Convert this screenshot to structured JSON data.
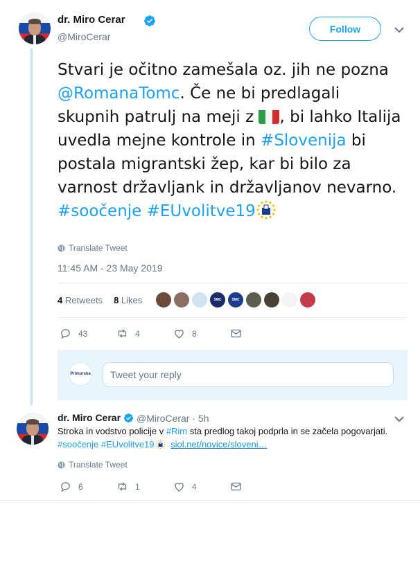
{
  "main_tweet": {
    "author_name": "dr. Miro Cerar",
    "author_handle": "@MiroCerar",
    "follow_label": "Follow",
    "text_parts": [
      {
        "type": "text",
        "value": "Stvari je očitno zamešala oz. jih ne pozna "
      },
      {
        "type": "link",
        "value": "@RomanaTomc"
      },
      {
        "type": "text",
        "value": ". Če ne bi predlagali skupnih patrulj na meji z "
      },
      {
        "type": "emoji",
        "value": "flag-italy"
      },
      {
        "type": "text",
        "value": ", bi lahko Italija uvedla mejne kontrole in "
      },
      {
        "type": "link",
        "value": "#Slovenija"
      },
      {
        "type": "text",
        "value": " bi postala migrantski žep, kar bi bilo za varnost državljank in državljanov nevarno. "
      },
      {
        "type": "link",
        "value": "#soočenje"
      },
      {
        "type": "text",
        "value": " "
      },
      {
        "type": "link",
        "value": "#EUvolitve19"
      },
      {
        "type": "emoji",
        "value": "eu-ballot"
      }
    ],
    "translate_label": "Translate Tweet",
    "timestamp": "11:45 AM - 23 May 2019",
    "retweets_count": "4",
    "retweets_label": "Retweets",
    "likes_count": "8",
    "likes_label": "Likes",
    "reply_count": "43",
    "retweet_count": "4",
    "like_count": "8"
  },
  "reply_box": {
    "placeholder": "Tweet your reply",
    "avatar_text": "Primorska"
  },
  "likers": [
    {
      "color": "#6b4a3a",
      "label": ""
    },
    {
      "color": "#8a6e66",
      "label": ""
    },
    {
      "color": "#cfe3f0",
      "label": ""
    },
    {
      "color": "#1b2a6b",
      "label": "SMC"
    },
    {
      "color": "#1b3c8c",
      "label": "SMC"
    },
    {
      "color": "#5c5e52",
      "label": ""
    },
    {
      "color": "#4a4036",
      "label": ""
    },
    {
      "color": "#f3f3f3",
      "label": ""
    },
    {
      "color": "#c23b4a",
      "label": ""
    }
  ],
  "second_tweet": {
    "author_name": "dr. Miro Cerar",
    "author_handle": "@MiroCerar",
    "time": "5h",
    "text_before": "Stroka in vodstvo policije v ",
    "link_1": "#Rim",
    "text_middle": " sta predlog takoj podprla in se začela pogovarjati. ",
    "link_2": "#soočenje",
    "link_3": "#EUvolitve19",
    "url": "siol.net/novice/sloveni…",
    "translate_label": "Translate Tweet",
    "reply_count": "6",
    "retweet_count": "1",
    "like_count": "4"
  },
  "colors": {
    "accent": "#1da1f2",
    "muted": "#657786",
    "thread_line": "#bfe4f6",
    "reply_bg": "#e8f5fd"
  }
}
